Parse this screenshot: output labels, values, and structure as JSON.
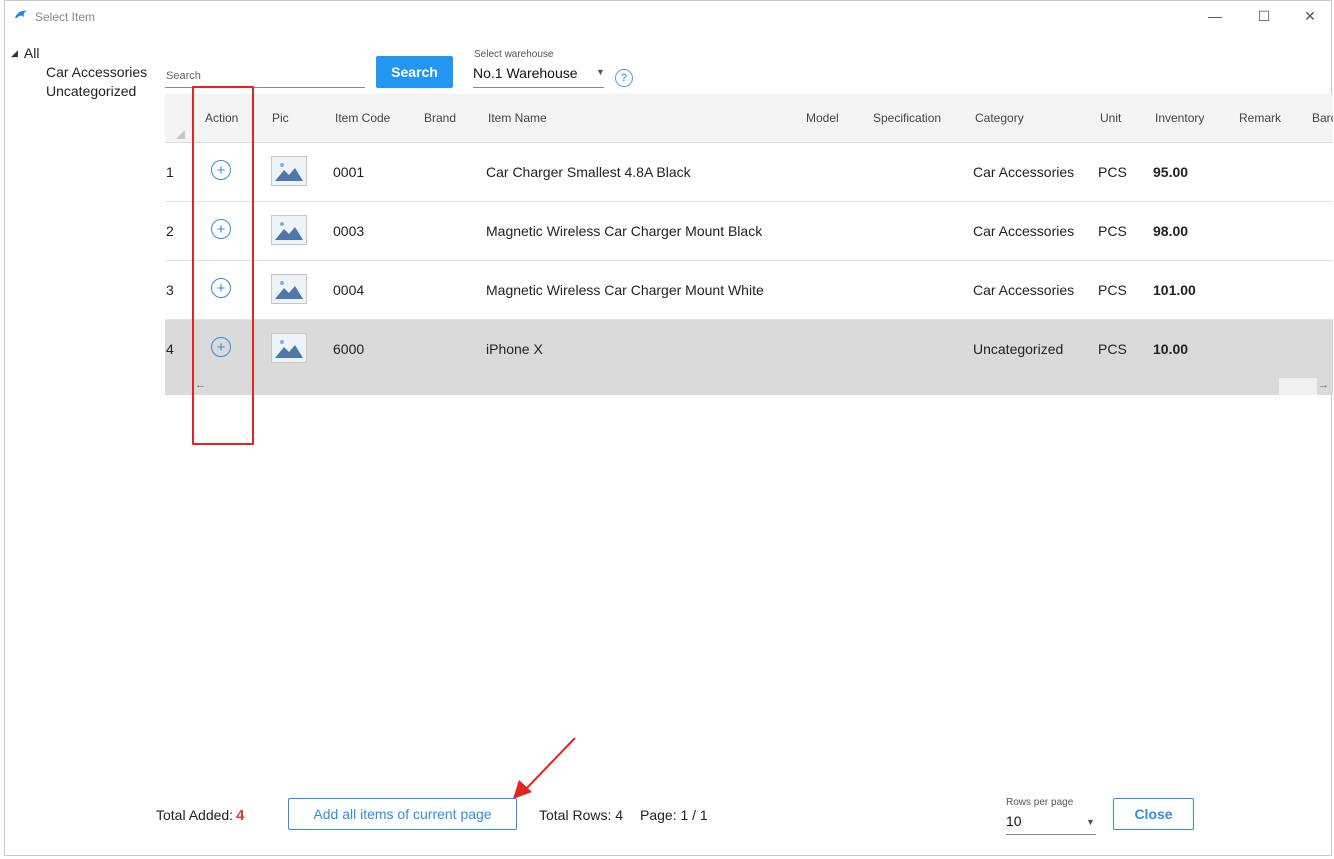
{
  "window": {
    "title": "Select Item"
  },
  "tree": {
    "root": "All",
    "items": [
      "Car Accessories",
      "Uncategorized"
    ]
  },
  "toolbar": {
    "search_placeholder": "Search",
    "search_button": "Search",
    "warehouse_label": "Select warehouse",
    "warehouse_value": "No.1  Warehouse",
    "help": "?"
  },
  "table": {
    "columns": [
      "Action",
      "Pic",
      "Item Code",
      "Brand",
      "Item Name",
      "Model",
      "Specification",
      "Category",
      "Unit",
      "Inventory",
      "Remark",
      "Barc"
    ],
    "rows": [
      {
        "index": "1",
        "code": "0001",
        "name": "Car Charger  Smallest 4.8A Black",
        "category": "Car Accessories",
        "unit": "PCS",
        "inventory": "95.00"
      },
      {
        "index": "2",
        "code": "0003",
        "name": "Magnetic Wireless Car Charger Mount Black",
        "category": "Car Accessories",
        "unit": "PCS",
        "inventory": "98.00"
      },
      {
        "index": "3",
        "code": "0004",
        "name": "Magnetic Wireless Car Charger Mount White",
        "category": "Car Accessories",
        "unit": "PCS",
        "inventory": "101.00"
      },
      {
        "index": "4",
        "code": "6000",
        "name": "iPhone X",
        "category": "Uncategorized",
        "unit": "PCS",
        "inventory": "10.00"
      }
    ],
    "add_glyph": "+"
  },
  "footer": {
    "total_added_label": "Total Added:",
    "total_added_value": "4",
    "add_all_button": "Add all items of current page",
    "total_rows": "Total Rows: 4",
    "page": "Page: 1 / 1",
    "rows_per_page_label": "Rows per page",
    "rows_per_page_value": "10",
    "close_button": "Close"
  },
  "colors": {
    "accent": "#2196f3",
    "annotation": "#e32222",
    "selected_row": "#dadada"
  },
  "icons": {
    "app": "dolphin-icon",
    "minimize": "minimize-icon",
    "maximize": "maximize-icon",
    "close": "close-icon"
  }
}
